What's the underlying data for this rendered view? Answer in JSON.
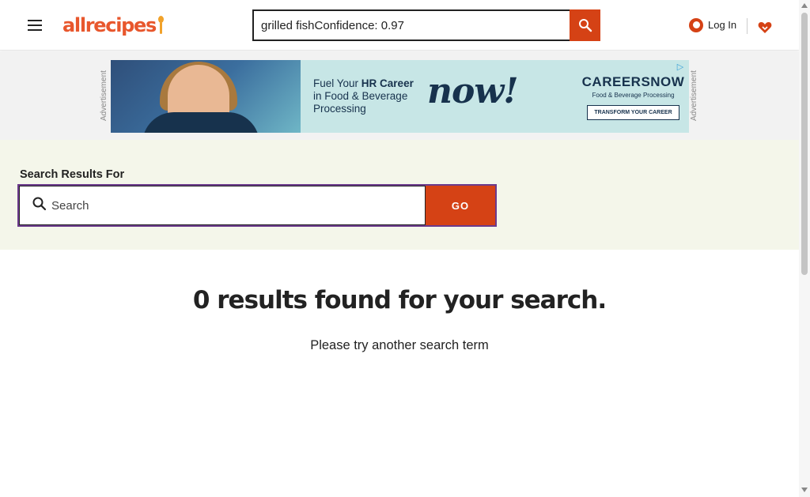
{
  "header": {
    "menu_icon": "hamburger-menu-icon",
    "logo_text": "allrecipes",
    "search": {
      "value": "grilled fishConfidence: 0.97",
      "button_icon": "search-icon"
    },
    "login_label": "Log In",
    "login_icon": "user-account-icon",
    "saved_icon": "heart-icon"
  },
  "ad": {
    "label": "Advertisement",
    "headline_prefix": "Fuel Your ",
    "headline_bold": "HR Career",
    "headline_rest": "in Food & Beverage Processing",
    "now_text": "now!",
    "brand_name": "CAREERSNOW",
    "brand_sub": "Food & Beverage Processing",
    "cta": "TRANSFORM YOUR CAREER",
    "choices_icon": "ad-choices-icon"
  },
  "results": {
    "heading": "Search Results For",
    "input_placeholder": "Search",
    "input_icon": "search-icon",
    "go_label": "GO",
    "no_results_title": "0 results found for your search.",
    "no_results_message": "Please try another search term"
  },
  "colors": {
    "accent": "#d54215",
    "logo": "#e8572d",
    "band": "#f4f6ea",
    "form_border": "#6b3a8c"
  }
}
